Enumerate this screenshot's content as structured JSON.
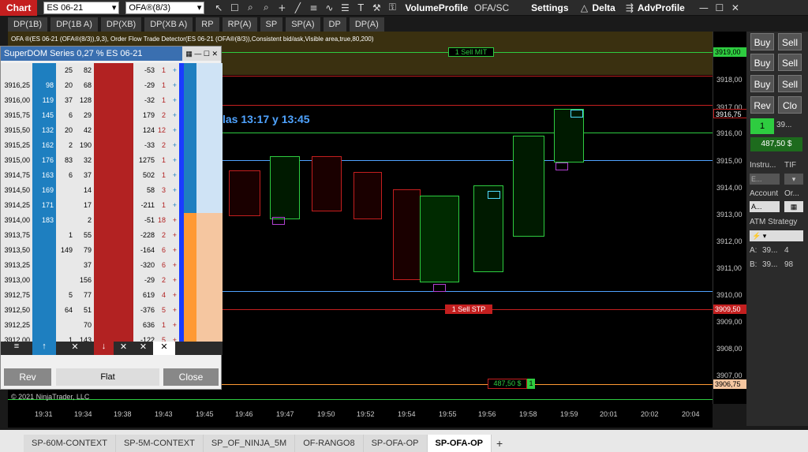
{
  "topbar": {
    "chart_tab": "Chart",
    "instrument": "ES 06-21",
    "indicator": "OFA®(8/3)",
    "volume_profile": "VolumeProfile",
    "ofa_sc": "OFA/SC",
    "settings": "Settings",
    "delta": "Delta",
    "advprofile": "AdvProfile"
  },
  "buttons": [
    "DP(1B)",
    "DP(1B A)",
    "DP(XB)",
    "DP(XB A)",
    "RP",
    "RP(A)",
    "SP",
    "SP(A)",
    "DP",
    "DP(A)"
  ],
  "chart": {
    "header": "OFA ®(ES 06-21 (OFA®(8/3)),9,3), Order Flow Trade Detector(ES 06-21 (OFA®(8/3)),Consistent bid/ask,Visible area,true,80,200)",
    "time_text": "las 13:17 y  13:45",
    "sell_mit": "1 Sell MIT",
    "sell_stp": "1 Sell STP",
    "pnl_label": "487,50 $",
    "pnl_qty": "1",
    "copyright": "© 2021 NinjaTrader, LLC"
  },
  "price_axis": [
    "3919,00",
    "3918,00",
    "3917,00",
    "3916,75",
    "3916,00",
    "3915,00",
    "3914,00",
    "3913,00",
    "3912,00",
    "3911,00",
    "3910,00",
    "3909,50",
    "3909,00",
    "3908,00",
    "3907,00",
    "3906,75"
  ],
  "time_axis": [
    "19:31",
    "19:34",
    "19:38",
    "19:43",
    "19:45",
    "19:46",
    "19:47",
    "19:50",
    "19:52",
    "19:54",
    "19:55",
    "19:56",
    "19:58",
    "19:59",
    "20:01",
    "20:02",
    "20:04"
  ],
  "right_panel": {
    "buy": "Buy",
    "sell": "Sell",
    "rev": "Rev",
    "close": "Clo",
    "qty": "1",
    "pos": "39...",
    "pnl": "487,50 $",
    "instrument_label": "Instru...",
    "tif_label": "TIF",
    "account_label": "Account",
    "order_label": "Or...",
    "atm_label": "ATM Strategy",
    "a_label": "A:",
    "a_val": "39...",
    "a_qty": "4",
    "b_label": "B:",
    "b_val": "39...",
    "b_qty": "98",
    "instr_value": "E...",
    "account_value": "A..."
  },
  "dom": {
    "title": "SuperDOM Series 0,27 % ES 06-21",
    "rows": [
      [
        "",
        "",
        "25",
        "82",
        "",
        "",
        "-53",
        "1",
        "+"
      ],
      [
        "3916,25",
        "98",
        "20",
        "68",
        "",
        "",
        "-29",
        "1",
        "+"
      ],
      [
        "3916,00",
        "119",
        "37",
        "128",
        "",
        "",
        "-32",
        "1",
        "+"
      ],
      [
        "3915,75",
        "145",
        "6",
        "29",
        "",
        "",
        "179",
        "2",
        "+"
      ],
      [
        "3915,50",
        "132",
        "20",
        "42",
        "",
        "",
        "124",
        "12",
        "+"
      ],
      [
        "3915,25",
        "162",
        "2",
        "190",
        "",
        "",
        "-33",
        "2",
        "+"
      ],
      [
        "3915,00",
        "176",
        "83",
        "32",
        "",
        "",
        "1275",
        "1",
        "+"
      ],
      [
        "3914,75",
        "163",
        "6",
        "37",
        "",
        "",
        "502",
        "1",
        "+"
      ],
      [
        "3914,50",
        "169",
        "",
        "14",
        "",
        "",
        "58",
        "3",
        "+"
      ],
      [
        "3914,25",
        "171",
        "",
        "17",
        "",
        "",
        "-211",
        "1",
        "+"
      ],
      [
        "3914,00",
        "183",
        "",
        "2",
        "",
        "",
        "-51",
        "18",
        "+"
      ],
      [
        "3913,75",
        "",
        "1",
        "55",
        "",
        "",
        "-228",
        "2",
        "+"
      ],
      [
        "3913,50",
        "",
        "149",
        "79",
        "",
        "",
        "-164",
        "6",
        "+"
      ],
      [
        "3913,25",
        "",
        "",
        "37",
        "",
        "",
        "-320",
        "6",
        "+"
      ],
      [
        "3913,00",
        "",
        "",
        "156",
        "",
        "",
        "-29",
        "2",
        "+"
      ],
      [
        "3912,75",
        "",
        "5",
        "77",
        "",
        "",
        "619",
        "4",
        "+"
      ],
      [
        "3912,50",
        "",
        "64",
        "51",
        "",
        "",
        "-376",
        "5",
        "+"
      ],
      [
        "3912,25",
        "",
        "",
        "70",
        "",
        "",
        "636",
        "1",
        "+"
      ],
      [
        "3912,00",
        "",
        "1",
        "143",
        "",
        "",
        "-122",
        "5",
        "+"
      ]
    ],
    "rev": "Rev",
    "flat": "Flat",
    "close": "Close"
  },
  "tabs": [
    "SP-60M-CONTEXT",
    "SP-5M-CONTEXT",
    "SP_OF_NINJA_5M",
    "OF-RANGO8",
    "SP-OFA-OP",
    "SP-OFA-OP"
  ],
  "colors": {
    "green": "#2ecc40",
    "red": "#e01e1e",
    "blue": "#4fa3ff",
    "dom_blue": "#1e7fc0",
    "dom_red": "#b22222",
    "orange": "#ff9933"
  }
}
